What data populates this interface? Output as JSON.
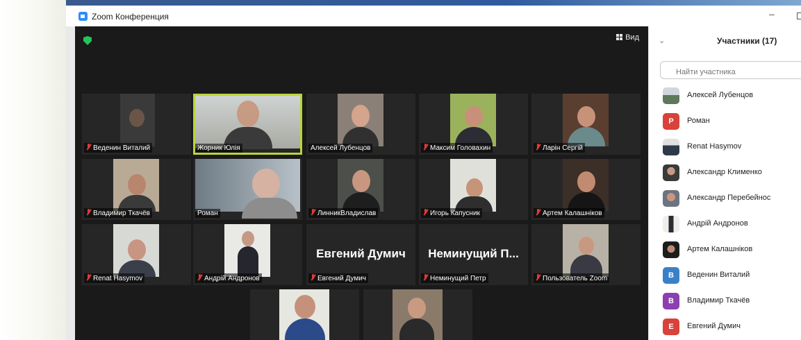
{
  "window": {
    "title": "Zoom Конференция"
  },
  "toolbar": {
    "view_label": "Вид"
  },
  "gallery": [
    {
      "label": "Веденин Виталий",
      "muted": true
    },
    {
      "label": "Жорник Юлія",
      "muted": false,
      "active": true
    },
    {
      "label": "Алексей Лубенцов",
      "muted": false
    },
    {
      "label": "Максим Головахин",
      "muted": true
    },
    {
      "label": "Ларін Сергій",
      "muted": true
    },
    {
      "label": "Владимир Ткачёв",
      "muted": true
    },
    {
      "label": "Роман",
      "muted": false
    },
    {
      "label": "ЛинникВладислав",
      "muted": true
    },
    {
      "label": "Игорь Капусник",
      "muted": true
    },
    {
      "label": "Артем Калашніков",
      "muted": true
    },
    {
      "label": "Renat Hasymov",
      "muted": true
    },
    {
      "label": "Андрій Андронов",
      "muted": true
    },
    {
      "label": "Евгений Думич",
      "muted": true,
      "display_name": "Евгений Думич"
    },
    {
      "label": "Неминущий Петр",
      "muted": true,
      "display_name": "Неминущий  П..."
    },
    {
      "label": "Пользователь Zoom",
      "muted": true
    },
    {
      "label": "",
      "muted": false
    },
    {
      "label": "",
      "muted": false
    }
  ],
  "participants_panel": {
    "title": "Участники (17)",
    "search_placeholder": "Найти участника",
    "items": [
      {
        "name": "Алексей Лубенцов",
        "avatar": "photo"
      },
      {
        "name": "Роман",
        "avatar": "letter",
        "letter": "Р",
        "color": "#d9423a"
      },
      {
        "name": "Renat Hasymov",
        "avatar": "photo"
      },
      {
        "name": "Александр Клименко",
        "avatar": "photo"
      },
      {
        "name": "Александр Перебейнос",
        "avatar": "photo"
      },
      {
        "name": "Андрій Андронов",
        "avatar": "photo"
      },
      {
        "name": "Артем Калашніков",
        "avatar": "photo"
      },
      {
        "name": "Веденин Виталий",
        "avatar": "letter",
        "letter": "В",
        "color": "#3a80c9"
      },
      {
        "name": "Владимир Ткачёв",
        "avatar": "letter",
        "letter": "В",
        "color": "#8b3fb0"
      },
      {
        "name": "Евгений Думич",
        "avatar": "letter",
        "letter": "Е",
        "color": "#d9423a"
      }
    ]
  },
  "colors": {
    "active_speaker": "#b9d43a",
    "mute": "#e03b3b",
    "shield": "#23c45b"
  }
}
